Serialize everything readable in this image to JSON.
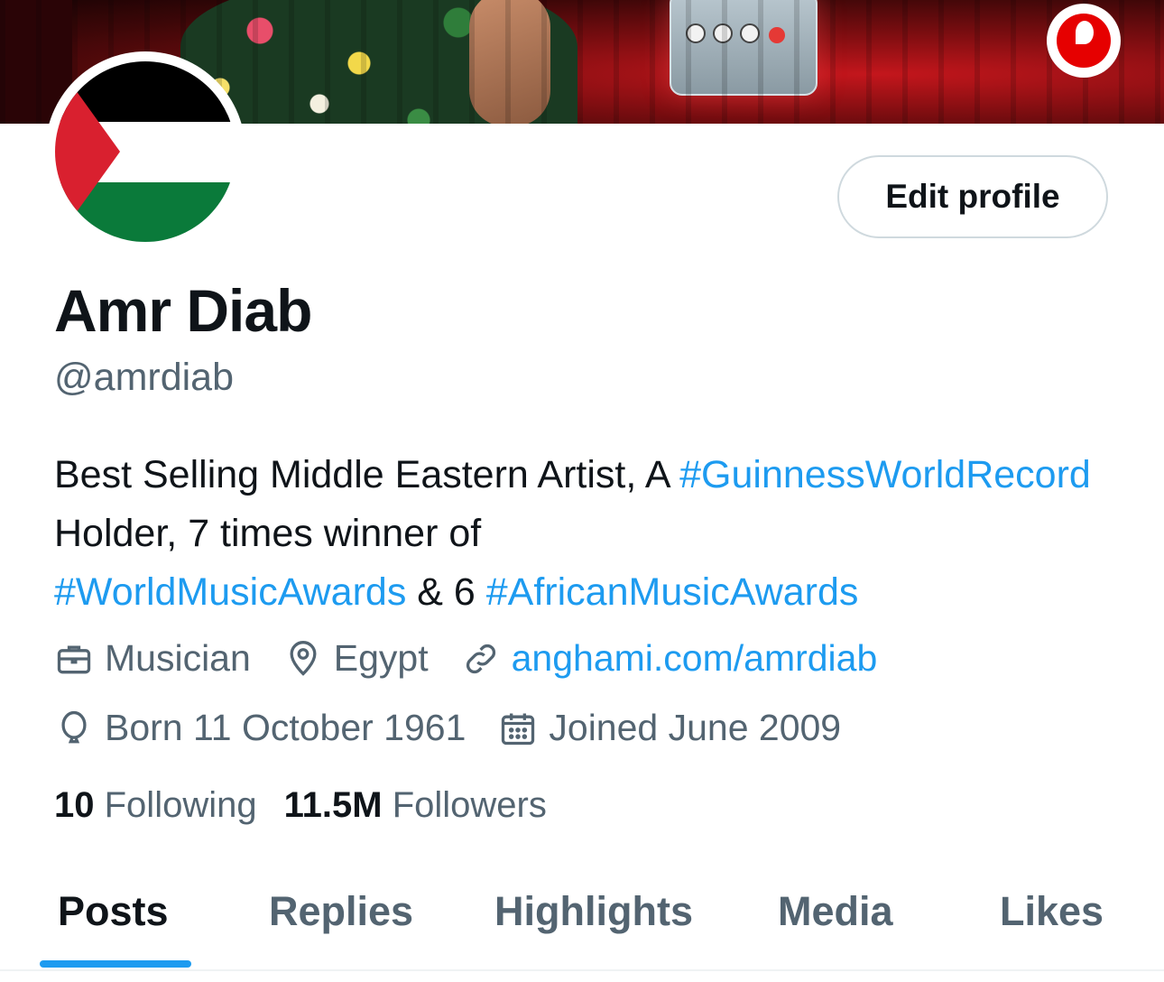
{
  "banner": {
    "brand_logo_icon": "vodafone-logo"
  },
  "avatar": {
    "image": "palestine-flag"
  },
  "profile": {
    "edit_button": "Edit profile",
    "name": "Amr Diab",
    "handle": "@amrdiab"
  },
  "bio": {
    "part1": "Best Selling Middle Eastern Artist, A ",
    "tag1": "#GuinnessWorldRecord",
    "part2": " Holder, 7 times winner of ",
    "tag2": "#WorldMusicAwards",
    "part3": " & 6 ",
    "tag3": "#AfricanMusicAwards"
  },
  "meta": {
    "profession": "Musician",
    "location": "Egypt",
    "website": "anghami.com/amrdiab",
    "birthday": "Born 11 October 1961",
    "joined": "Joined June 2009"
  },
  "stats": {
    "following_count": "10",
    "following_label": "Following",
    "followers_count": "11.5M",
    "followers_label": "Followers"
  },
  "tabs": [
    {
      "label": "Posts",
      "active": true
    },
    {
      "label": "Replies",
      "active": false
    },
    {
      "label": "Highlights",
      "active": false
    },
    {
      "label": "Media",
      "active": false
    },
    {
      "label": "Likes",
      "active": false
    }
  ],
  "colors": {
    "accent": "#1d9bf0",
    "text_primary": "#0f1419",
    "text_secondary": "#536471"
  }
}
